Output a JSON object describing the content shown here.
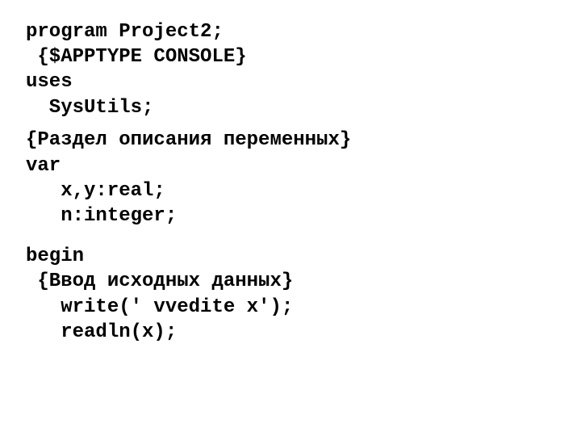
{
  "code": {
    "l1": "program Project2;",
    "l2": " {$APPTYPE CONSOLE}",
    "l3": "uses",
    "l4": "  SysUtils;",
    "l5": "{Раздел описания переменных}",
    "l6": "var",
    "l7": "   x,y:real;",
    "l8": "   n:integer;",
    "l9": "begin",
    "l10": " {Ввод исходных данных}",
    "l11": "   write(' vvedite x');",
    "l12": "   readln(x);"
  }
}
